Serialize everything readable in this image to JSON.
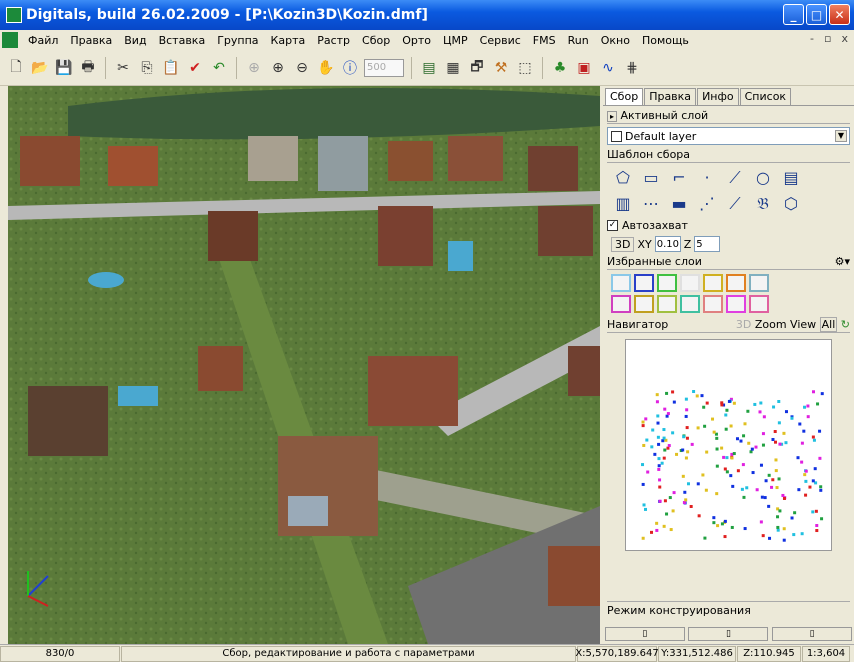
{
  "window": {
    "title": "Digitals, build 26.02.2009 - [P:\\Kozin3D\\Kozin.dmf]",
    "minimize": "_",
    "maximize": "□",
    "close": "✕"
  },
  "menu": {
    "items": [
      "Файл",
      "Правка",
      "Вид",
      "Вставка",
      "Группа",
      "Карта",
      "Растр",
      "Сбор",
      "Орто",
      "ЦМР",
      "Сервис",
      "FMS",
      "Run",
      "Окно",
      "Помощь"
    ],
    "mdi_min": "-",
    "mdi_restore": "▫",
    "mdi_close": "x"
  },
  "toolbar": {
    "zoom_value": "500"
  },
  "panel": {
    "tabs": [
      "Сбор",
      "Правка",
      "Инфо",
      "Список"
    ],
    "active_layer_label": "Активный слой",
    "active_layer_value": "Default layer",
    "template_label": "Шаблон сбора",
    "autocapture_label": "Автозахват",
    "btn_3d": "3D",
    "xy_label": "XY",
    "xy_value": "0.10",
    "z_label": "Z",
    "z_value": "5",
    "fav_layers_label": "Избранные слои",
    "navigator_label": "Навигатор",
    "navigator_3d": "3D",
    "zoom_view": "Zoom View",
    "all": "All",
    "construct_label": "Режим конструирования"
  },
  "status": {
    "count": "830/0",
    "message": "Сбор, редактирование и работа с параметрами",
    "x": "X:5,570,189.647",
    "y": "Y:331,512.486",
    "z": "Z:110.945",
    "scale": "1:3,604"
  },
  "colors": {
    "titlebar": "#0a5ae0",
    "panel_bg": "#ece9d8",
    "map_bg": "#5b7a3a"
  }
}
